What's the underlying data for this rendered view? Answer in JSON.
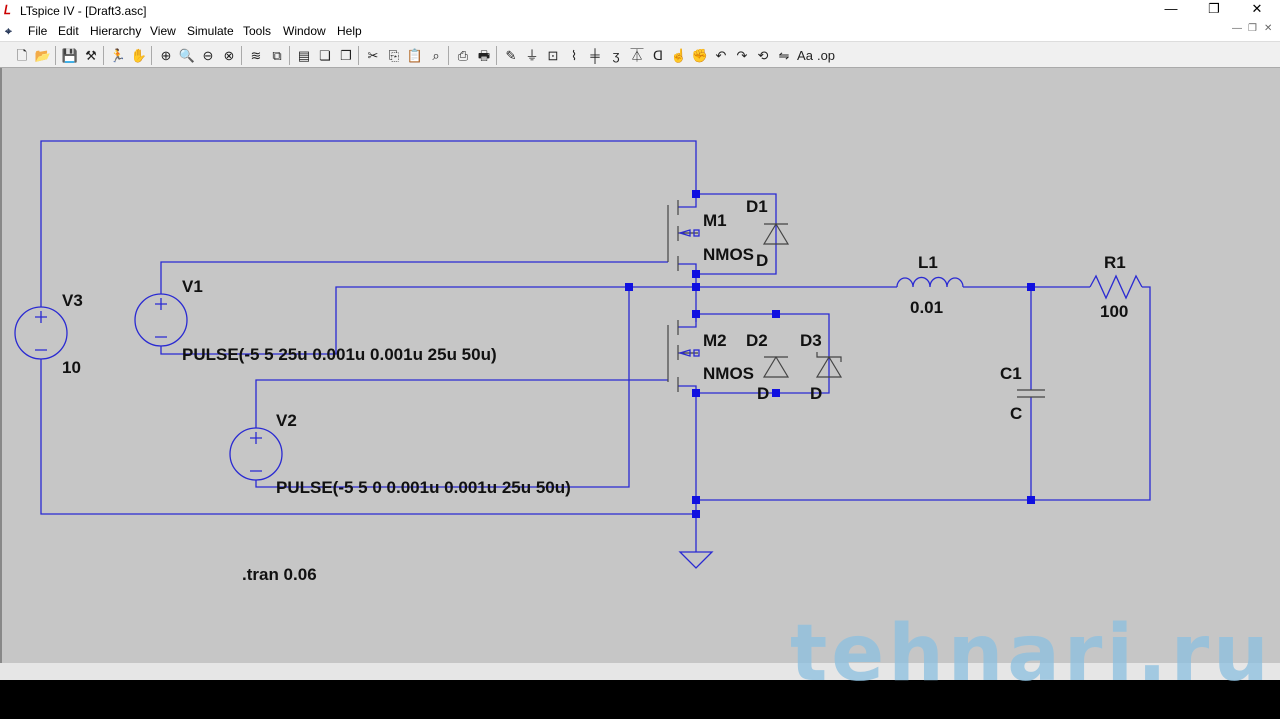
{
  "window": {
    "title": "LTspice IV - [Draft3.asc]",
    "minimize": "—",
    "restore": "❐",
    "close": "✕"
  },
  "menu": [
    "File",
    "Edit",
    "Hierarchy",
    "View",
    "Simulate",
    "Tools",
    "Window",
    "Help"
  ],
  "toolbar": [
    {
      "name": "new-schematic",
      "glyph": "🗋"
    },
    {
      "name": "open",
      "glyph": "📂"
    },
    {
      "name": "save",
      "glyph": "💾"
    },
    {
      "name": "control-panel",
      "glyph": "⚒"
    },
    {
      "name": "run",
      "glyph": "🏃"
    },
    {
      "name": "halt",
      "glyph": "✋"
    },
    {
      "name": "zoom-in",
      "glyph": "⊕"
    },
    {
      "name": "pan",
      "glyph": "🔍"
    },
    {
      "name": "zoom-out",
      "glyph": "⊖"
    },
    {
      "name": "zoom-fit",
      "glyph": "⊗"
    },
    {
      "name": "autorange",
      "glyph": "≋"
    },
    {
      "name": "fft",
      "glyph": "⧉"
    },
    {
      "name": "tile-horizontal",
      "glyph": "▤"
    },
    {
      "name": "cascade",
      "glyph": "❏"
    },
    {
      "name": "close-windows",
      "glyph": "❐"
    },
    {
      "name": "cut",
      "glyph": "✂"
    },
    {
      "name": "copy",
      "glyph": "⎘"
    },
    {
      "name": "paste",
      "glyph": "📋"
    },
    {
      "name": "find",
      "glyph": "⌕"
    },
    {
      "name": "print-preview",
      "glyph": "⎙"
    },
    {
      "name": "print",
      "glyph": "🖶"
    },
    {
      "name": "draw-wire",
      "glyph": "✎"
    },
    {
      "name": "ground",
      "glyph": "⏚"
    },
    {
      "name": "label-net",
      "glyph": "⊡"
    },
    {
      "name": "resistor",
      "glyph": "⌇"
    },
    {
      "name": "capacitor",
      "glyph": "╪"
    },
    {
      "name": "inductor",
      "glyph": "ʒ"
    },
    {
      "name": "diode",
      "glyph": "⏄"
    },
    {
      "name": "component",
      "glyph": "ᗡ"
    },
    {
      "name": "move",
      "glyph": "☝"
    },
    {
      "name": "drag",
      "glyph": "✊"
    },
    {
      "name": "undo",
      "glyph": "↶"
    },
    {
      "name": "redo",
      "glyph": "↷"
    },
    {
      "name": "rotate",
      "glyph": "⟲"
    },
    {
      "name": "mirror",
      "glyph": "⇋"
    },
    {
      "name": "text",
      "glyph": "Aa"
    },
    {
      "name": "spice-directive",
      "glyph": ".op"
    }
  ],
  "schematic": {
    "V3": {
      "name": "V3",
      "value": "10"
    },
    "V1": {
      "name": "V1",
      "value": "PULSE(-5 5 25u 0.001u 0.001u 25u 50u)"
    },
    "V2": {
      "name": "V2",
      "value": "PULSE(-5 5 0 0.001u 0.001u 25u 50u)"
    },
    "M1": {
      "name": "M1",
      "model": "NMOS"
    },
    "M2": {
      "name": "M2",
      "model": "NMOS"
    },
    "D1": {
      "name": "D1",
      "model": "D"
    },
    "D2": {
      "name": "D2",
      "model": "D"
    },
    "D3": {
      "name": "D3",
      "model": "D"
    },
    "L1": {
      "name": "L1",
      "value": "0.01"
    },
    "R1": {
      "name": "R1",
      "value": "100"
    },
    "C1": {
      "name": "C1",
      "value": "C"
    },
    "directive": ".tran 0.06"
  },
  "watermark": "tehnari.ru"
}
